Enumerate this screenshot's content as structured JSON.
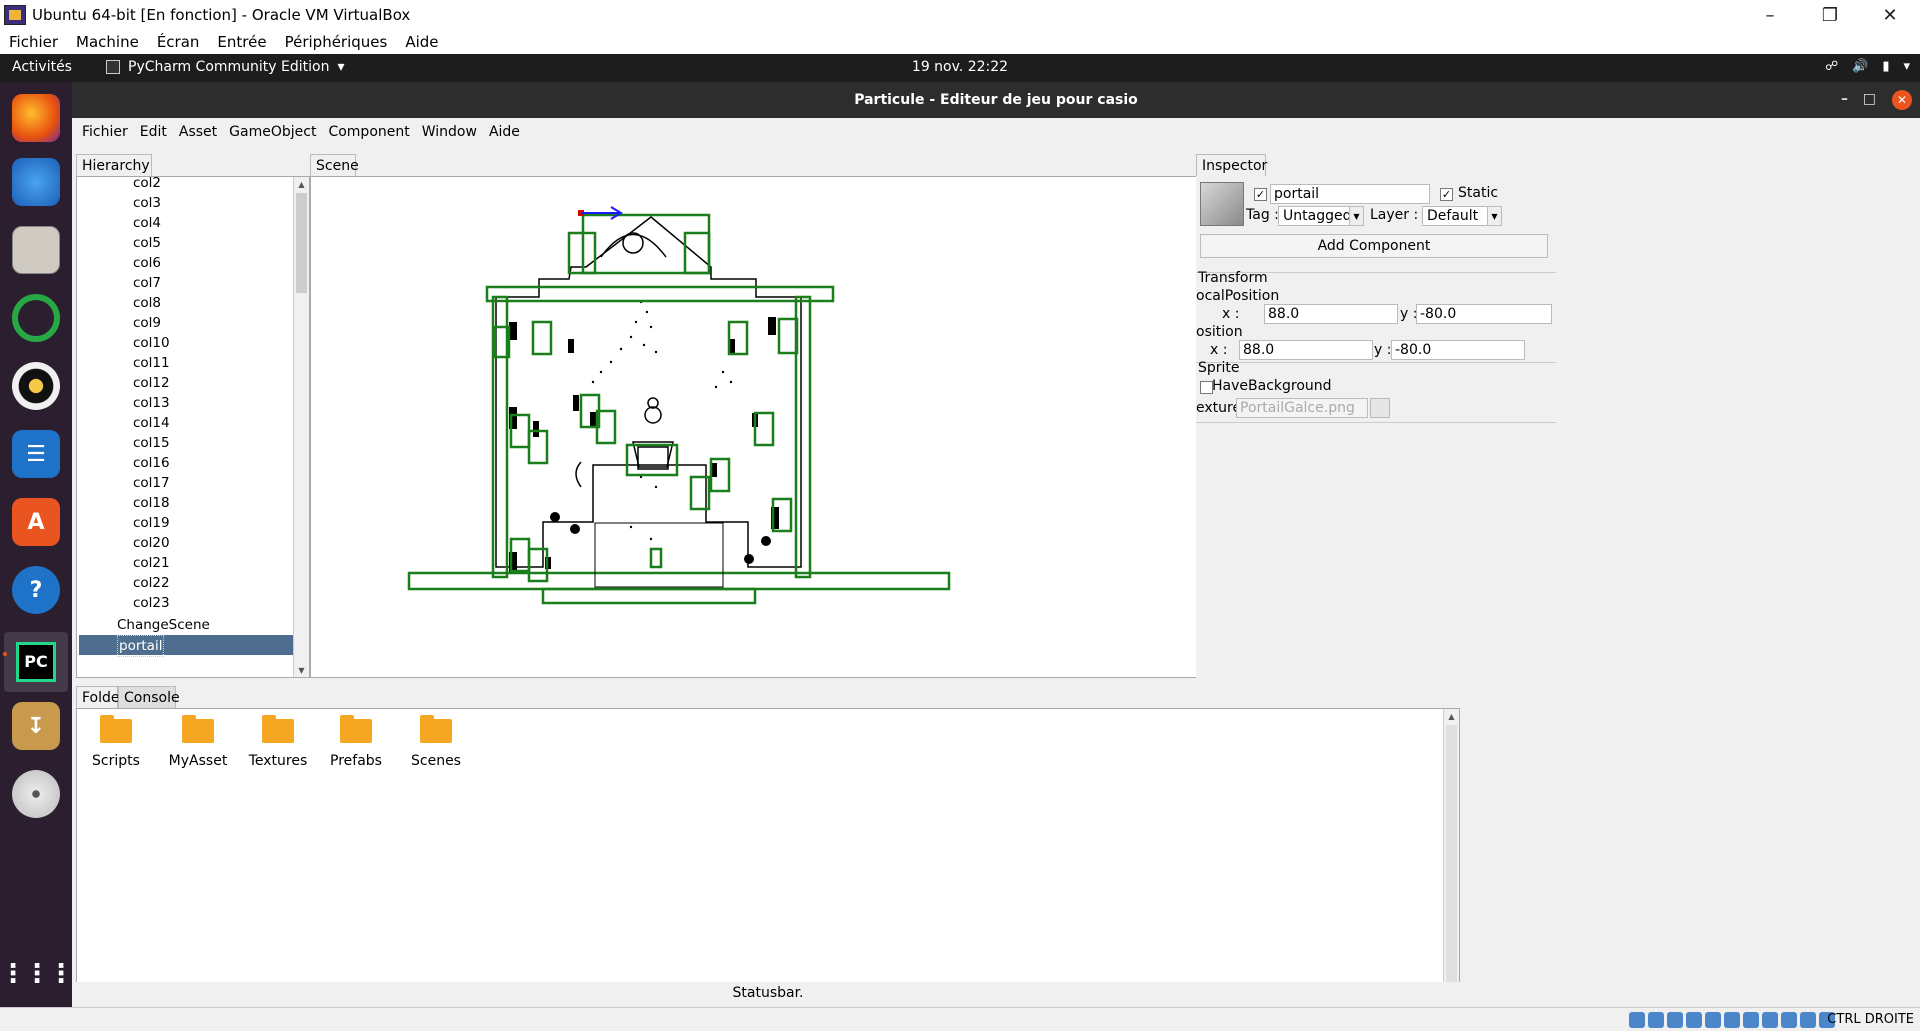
{
  "vbox": {
    "title": "Ubuntu 64-bit [En fonction] - Oracle VM VirtualBox",
    "menu": [
      "Fichier",
      "Machine",
      "Écran",
      "Entrée",
      "Périphériques",
      "Aide"
    ],
    "host_key": "CTRL DROITE"
  },
  "gnome": {
    "activities": "Activités",
    "app_menu": "PyCharm Community Edition",
    "clock": "19 nov.  22:22"
  },
  "app": {
    "title": "Particule - Editeur de jeu pour casio",
    "menu": [
      "Fichier",
      "Edit",
      "Asset",
      "GameObject",
      "Component",
      "Window",
      "Aide"
    ],
    "statusbar": "Statusbar."
  },
  "hierarchy": {
    "tab": "Hierarchy",
    "items": [
      "col2",
      "col3",
      "col4",
      "col5",
      "col6",
      "col7",
      "col8",
      "col9",
      "col10",
      "col11",
      "col12",
      "col13",
      "col14",
      "col15",
      "col16",
      "col17",
      "col18",
      "col19",
      "col20",
      "col21",
      "col22",
      "col23"
    ],
    "change_scene": "ChangeScene",
    "selected": "portail"
  },
  "scene": {
    "tab": "Scene"
  },
  "bottom": {
    "tabs": [
      "Folder",
      "Console"
    ],
    "folders": [
      "Scripts",
      "MyAsset",
      "Textures",
      "Prefabs",
      "Scenes"
    ]
  },
  "inspector": {
    "tab": "Inspector",
    "name": "portail",
    "static_label": "Static",
    "tag_label": "Tag :",
    "tag_value": "Untagged",
    "layer_label": "Layer :",
    "layer_value": "Default",
    "add_component": "Add Component",
    "transform": {
      "header": "Transform",
      "local_label": "ocalPosition",
      "local_x_label": "x :",
      "local_x": "88.0",
      "local_y_label": "y :",
      "local_y": "-80.0",
      "pos_label": "osition",
      "pos_x_label": "x :",
      "pos_x": "88.0",
      "pos_y_label": "y :",
      "pos_y": "-80.0"
    },
    "sprite": {
      "header": "Sprite",
      "have_bg_label": "HaveBackground",
      "texture_label": "exture",
      "texture_value": "PortailGalce.png"
    }
  },
  "colors": {
    "collider": "#1a7f1a",
    "selection": "#4f6d8f",
    "dock_bg": "#2b1f2f",
    "gnome_bar": "#1d1d1d"
  }
}
